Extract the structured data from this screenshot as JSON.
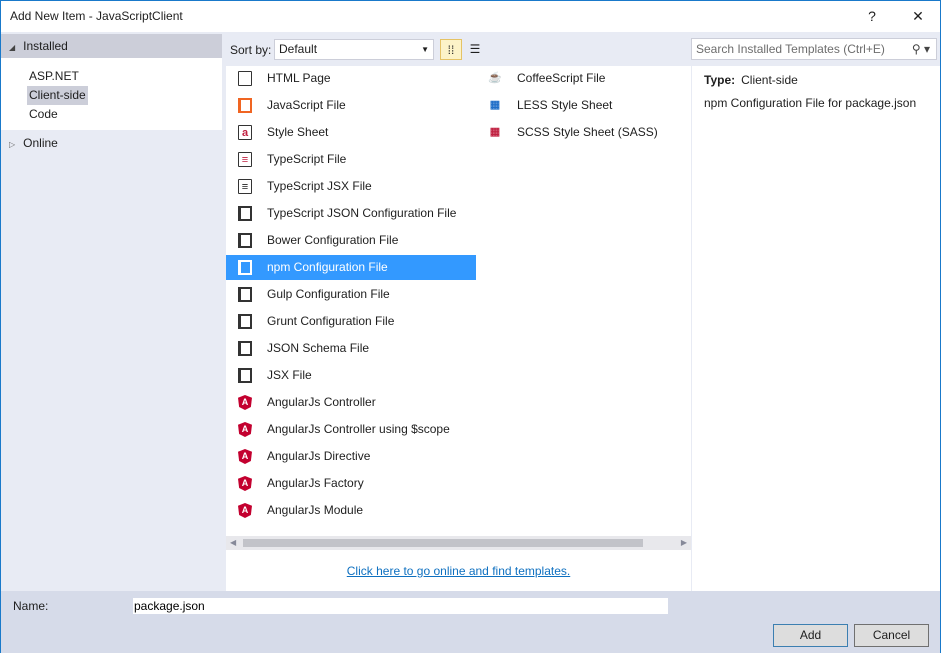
{
  "window": {
    "title": "Add New Item - JavaScriptClient",
    "help": "?",
    "close": "✕"
  },
  "sidebar": {
    "installed": "Installed",
    "categories": [
      "ASP.NET",
      "Client-side",
      "Code"
    ],
    "online": "Online"
  },
  "toolbar": {
    "sort_label": "Sort by:",
    "sort_value": "Default",
    "search_placeholder": "Search Installed Templates (Ctrl+E)"
  },
  "templates_col1": [
    {
      "label": "HTML Page",
      "icon": "html-page-icon"
    },
    {
      "label": "JavaScript File",
      "icon": "javascript-file-icon"
    },
    {
      "label": "Style Sheet",
      "icon": "style-sheet-icon"
    },
    {
      "label": "TypeScript File",
      "icon": "typescript-file-icon"
    },
    {
      "label": "TypeScript JSX File",
      "icon": "typescript-jsx-file-icon"
    },
    {
      "label": "TypeScript JSON Configuration File",
      "icon": "config-file-icon"
    },
    {
      "label": "Bower Configuration File",
      "icon": "config-file-icon"
    },
    {
      "label": "npm Configuration File",
      "icon": "config-file-icon"
    },
    {
      "label": "Gulp Configuration File",
      "icon": "config-file-icon"
    },
    {
      "label": "Grunt Configuration File",
      "icon": "config-file-icon"
    },
    {
      "label": "JSON Schema File",
      "icon": "config-file-icon"
    },
    {
      "label": "JSX File",
      "icon": "jsx-file-icon"
    },
    {
      "label": "AngularJs Controller",
      "icon": "angular-icon"
    },
    {
      "label": "AngularJs Controller using $scope",
      "icon": "angular-icon"
    },
    {
      "label": "AngularJs Directive",
      "icon": "angular-icon"
    },
    {
      "label": "AngularJs Factory",
      "icon": "angular-icon"
    },
    {
      "label": "AngularJs Module",
      "icon": "angular-icon"
    }
  ],
  "templates_col2": [
    {
      "label": "CoffeeScript File",
      "icon": "coffee-icon"
    },
    {
      "label": "LESS Style Sheet",
      "icon": "less-icon"
    },
    {
      "label": "SCSS Style Sheet (SASS)",
      "icon": "scss-icon"
    }
  ],
  "selected_template": "npm Configuration File",
  "online_link": "Click here to go online and find templates.",
  "details": {
    "type_label": "Type:",
    "type_value": "Client-side",
    "description": "npm Configuration File for package.json"
  },
  "footer": {
    "name_label": "Name:",
    "name_value": "package.json",
    "add": "Add",
    "cancel": "Cancel"
  }
}
